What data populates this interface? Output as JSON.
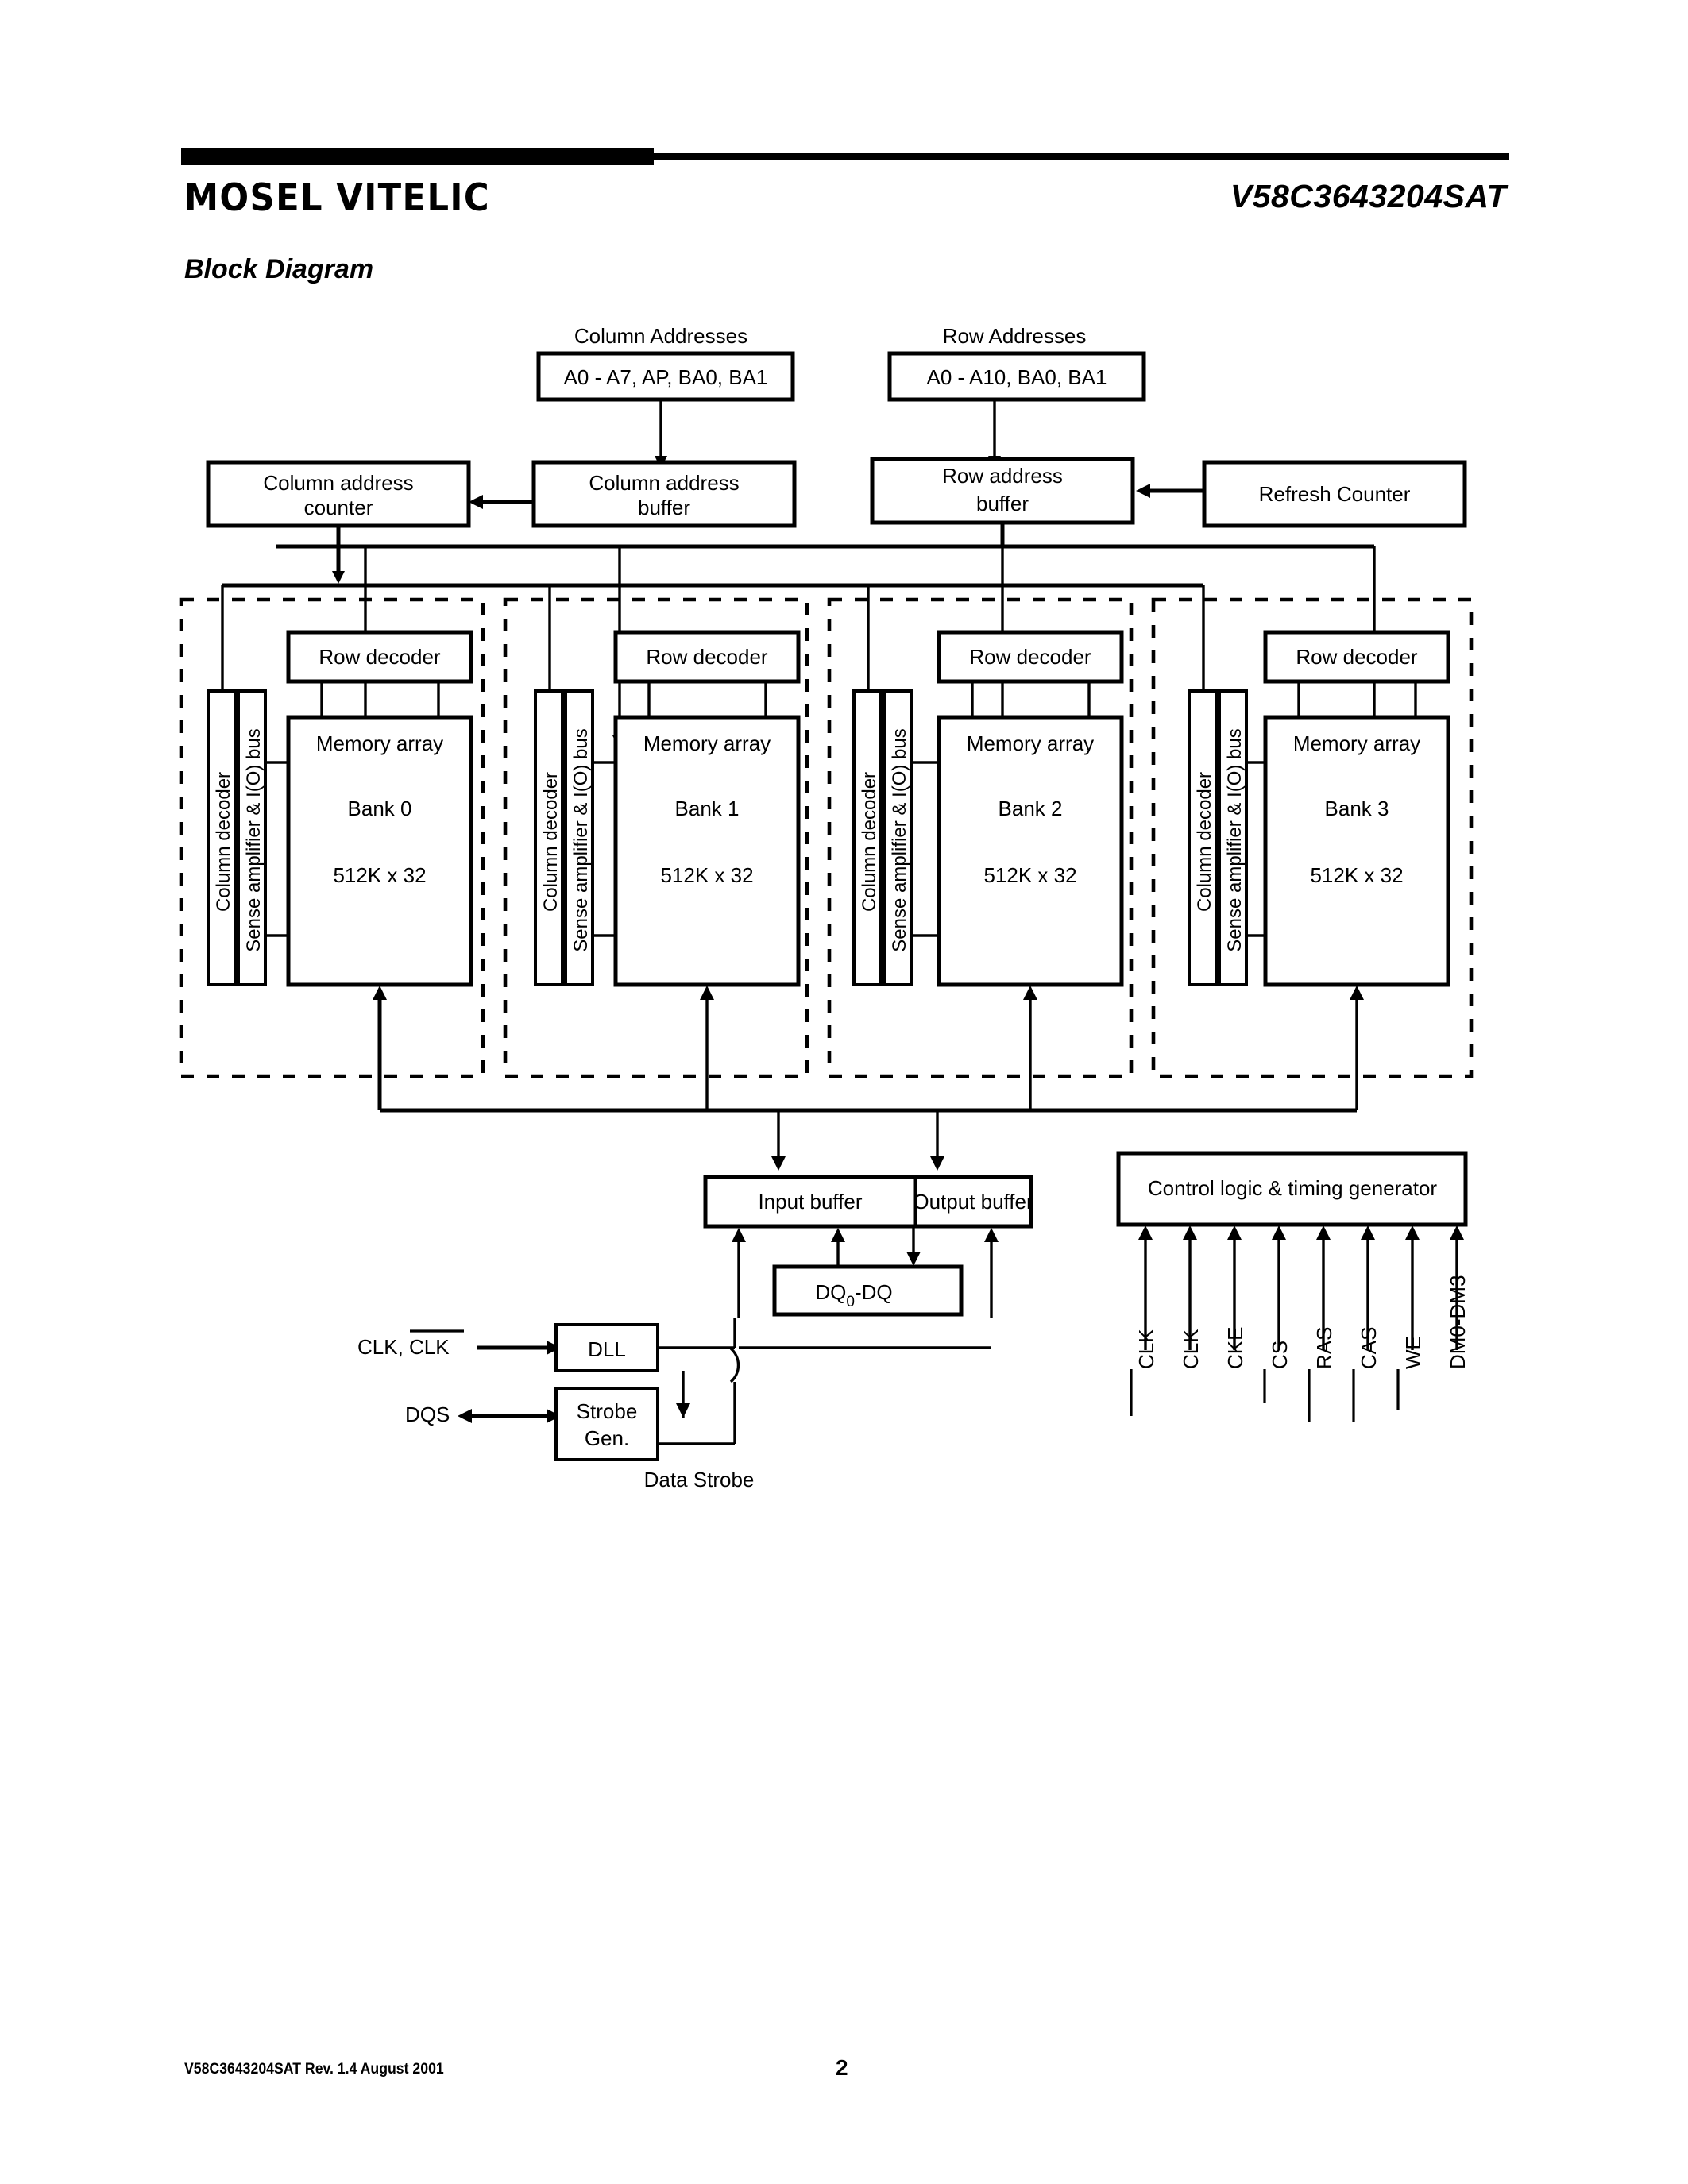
{
  "header": {
    "brand": "MOSEL VITELIC",
    "part_number": "V58C3643204SAT",
    "section_title": "Block Diagram"
  },
  "footer": {
    "doc_line": "V58C3643204SAT  Rev. 1.4 August 2001",
    "page_number": "2"
  },
  "diagram": {
    "address_inputs": [
      {
        "caption": "Column Addresses",
        "value": "A0 - A7, AP, BA0, BA1"
      },
      {
        "caption": "Row Addresses",
        "value": "A0 - A10, BA0, BA1"
      }
    ],
    "address_blocks": [
      {
        "line1": "Column address",
        "line2": "counter"
      },
      {
        "line1": "Column address",
        "line2": "buffer"
      },
      {
        "line1": "Row address",
        "line2": "buffer"
      },
      {
        "line1": "Refresh Counter",
        "line2": ""
      }
    ],
    "bank_common": {
      "row_decoder": "Row decoder",
      "column_decoder": "Column decoder",
      "sense_amp": "Sense amplifier & I(O) bus",
      "array_title": "Memory array",
      "array_size": "512K x 32"
    },
    "banks": [
      {
        "name": "Bank 0"
      },
      {
        "name": "Bank 1"
      },
      {
        "name": "Bank 2"
      },
      {
        "name": "Bank 3"
      }
    ],
    "io_blocks": {
      "input_buffer": "Input buffer",
      "output_buffer": "Output buffer",
      "dq_prefix": "DQ",
      "dq_sub": "0",
      "dq_suffix": "-DQ",
      "control_logic": "Control logic & timing generator"
    },
    "clock_section": {
      "clk_input_plain": "CLK, ",
      "clk_input_bar": "CLK",
      "dll": "DLL",
      "dqs": "DQS",
      "strobe_line1": "Strobe",
      "strobe_line2": "Gen.",
      "data_strobe": "Data Strobe"
    },
    "control_signals": [
      {
        "label": "CLK",
        "overbar": true
      },
      {
        "label": "CLK",
        "overbar": false
      },
      {
        "label": "CKE",
        "overbar": false
      },
      {
        "label": "CS",
        "overbar": true
      },
      {
        "label": "RAS",
        "overbar": true
      },
      {
        "label": "CAS",
        "overbar": true
      },
      {
        "label": "WE",
        "overbar": true
      },
      {
        "label": "DM0-DM3",
        "overbar": false
      }
    ]
  }
}
